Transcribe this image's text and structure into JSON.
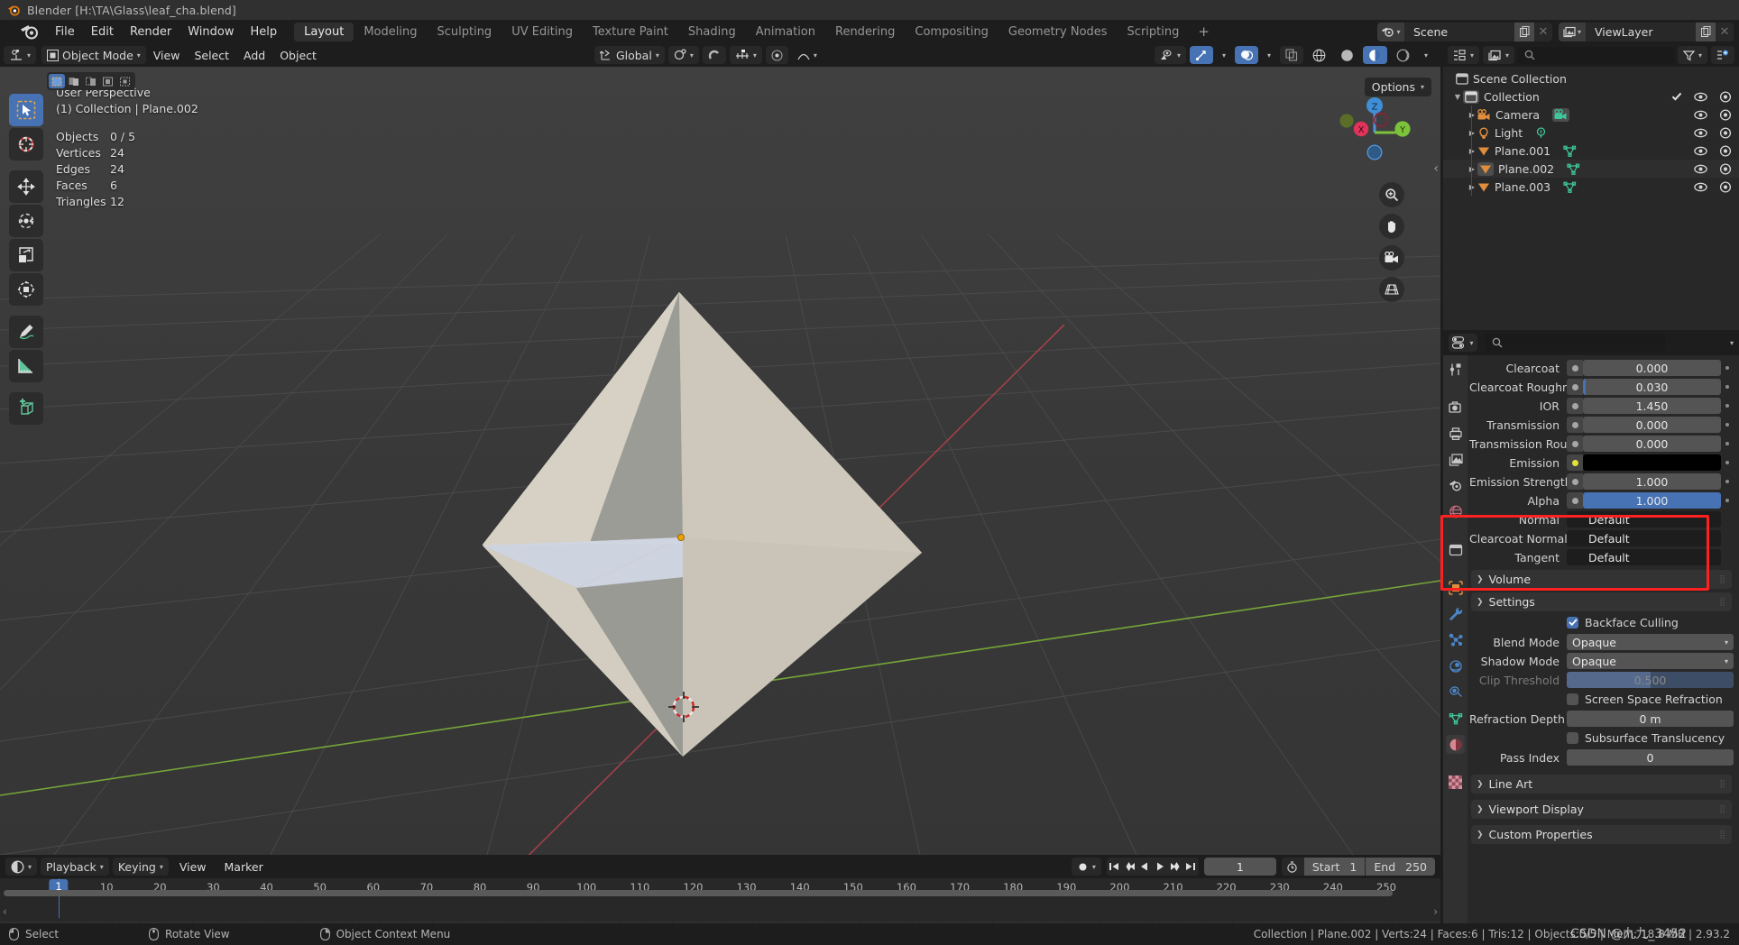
{
  "window": {
    "title": "Blender [H:\\TA\\Glass\\leaf_cha.blend]"
  },
  "menubar": {
    "items": [
      "File",
      "Edit",
      "Render",
      "Window",
      "Help"
    ],
    "workspaces": [
      "Layout",
      "Modeling",
      "Sculpting",
      "UV Editing",
      "Texture Paint",
      "Shading",
      "Animation",
      "Rendering",
      "Compositing",
      "Geometry Nodes",
      "Scripting"
    ],
    "active_workspace": "Layout",
    "add_workspace": "+",
    "scene_name": "Scene",
    "viewlayer_name": "ViewLayer"
  },
  "viewport_header": {
    "mode": "Object Mode",
    "menus": [
      "View",
      "Select",
      "Add",
      "Object"
    ],
    "transform_orientation": "Global",
    "options_label": "Options"
  },
  "viewport": {
    "perspective": "User Perspective",
    "collection_line": "(1) Collection | Plane.002",
    "stats": [
      {
        "label": "Objects",
        "value": "0 / 5"
      },
      {
        "label": "Vertices",
        "value": "24"
      },
      {
        "label": "Edges",
        "value": "24"
      },
      {
        "label": "Faces",
        "value": "6"
      },
      {
        "label": "Triangles",
        "value": "12"
      }
    ],
    "gizmo_axes": [
      "Z",
      "X",
      "Y"
    ]
  },
  "outliner": {
    "root": "Scene Collection",
    "rows": [
      {
        "name": "Collection",
        "indent": 1,
        "type": "collection",
        "selected": false,
        "disclosure": "▼",
        "has_check": true
      },
      {
        "name": "Camera",
        "indent": 2,
        "type": "camera",
        "selected": false,
        "disclosure": "▶",
        "has_check": false
      },
      {
        "name": "Light",
        "indent": 2,
        "type": "light",
        "selected": false,
        "disclosure": "▶",
        "has_check": false
      },
      {
        "name": "Plane.001",
        "indent": 2,
        "type": "mesh",
        "selected": false,
        "disclosure": "▶",
        "has_check": false
      },
      {
        "name": "Plane.002",
        "indent": 2,
        "type": "mesh",
        "selected": true,
        "disclosure": "▶",
        "has_check": false
      },
      {
        "name": "Plane.003",
        "indent": 2,
        "type": "mesh",
        "selected": false,
        "disclosure": "▶",
        "has_check": false
      }
    ]
  },
  "properties": {
    "fields": [
      {
        "label": "Clearcoat",
        "value": "0.000",
        "style": "grey",
        "socket": "grey"
      },
      {
        "label": "Clearcoat Roughn...",
        "value": "0.030",
        "style": "slider",
        "socket": "grey"
      },
      {
        "label": "IOR",
        "value": "1.450",
        "style": "grey",
        "socket": "grey"
      },
      {
        "label": "Transmission",
        "value": "0.000",
        "style": "grey",
        "socket": "grey"
      },
      {
        "label": "Transmission Rou...",
        "value": "0.000",
        "style": "grey",
        "socket": "grey"
      },
      {
        "label": "Emission",
        "value": "",
        "style": "black",
        "socket": "yellow"
      },
      {
        "label": "Emission Strength",
        "value": "1.000",
        "style": "grey",
        "socket": "grey"
      },
      {
        "label": "Alpha",
        "value": "1.000",
        "style": "blue",
        "socket": "grey"
      },
      {
        "label": "Normal",
        "value": "Default",
        "style": "dark",
        "socket": "violet"
      },
      {
        "label": "Clearcoat Normal",
        "value": "Default",
        "style": "dark",
        "socket": "violet"
      },
      {
        "label": "Tangent",
        "value": "Default",
        "style": "dark",
        "socket": "violet"
      }
    ],
    "panels": {
      "volume": "Volume",
      "settings": "Settings",
      "line_art": "Line Art",
      "viewport_display": "Viewport Display",
      "custom_properties": "Custom Properties"
    },
    "settings": {
      "backface_culling_label": "Backface Culling",
      "backface_culling_checked": true,
      "blend_mode_label": "Blend Mode",
      "blend_mode_value": "Opaque",
      "shadow_mode_label": "Shadow Mode",
      "shadow_mode_value": "Opaque",
      "clip_threshold_label": "Clip Threshold",
      "clip_threshold_value": "0.500",
      "screen_space_refraction_label": "Screen Space Refraction",
      "screen_space_refraction_checked": false,
      "refraction_depth_label": "Refraction Depth",
      "refraction_depth_value": "0 m",
      "subsurface_translucency_label": "Subsurface Translucency",
      "subsurface_translucency_checked": false,
      "pass_index_label": "Pass Index",
      "pass_index_value": "0"
    },
    "highlight_color": "#ff2020"
  },
  "timeline": {
    "menus": [
      "Playback",
      "Keying",
      "View",
      "Marker"
    ],
    "current_frame": "1",
    "start_label": "Start",
    "start_value": "1",
    "end_label": "End",
    "end_value": "250",
    "ticks": [
      "1",
      "10",
      "20",
      "30",
      "40",
      "50",
      "60",
      "70",
      "80",
      "90",
      "100",
      "110",
      "120",
      "130",
      "140",
      "150",
      "160",
      "170",
      "180",
      "190",
      "200",
      "210",
      "220",
      "230",
      "240",
      "250"
    ],
    "playhead_frame": "1"
  },
  "statusbar": {
    "hints": [
      {
        "label": "Select",
        "icon": "mouse-left-icon"
      },
      {
        "label": "Rotate View",
        "icon": "mouse-middle-icon"
      },
      {
        "label": "Object Context Menu",
        "icon": "mouse-right-icon"
      }
    ],
    "scene_stats": "Collection | Plane.002 | Verts:24 | Faces:6 | Tris:12 | Objects:0/5 | Mem: 18.8 MB | 2.93.2",
    "watermark": "CSDN @九九_3452"
  },
  "colors": {
    "accent_blue": "#4772b3",
    "highlight_red": "#ff2020",
    "panel_bg": "#282828",
    "header_bg": "#1d1d1d",
    "viewport_bg": "#3b3b3b",
    "mesh_orange": "#e08d3c",
    "mesh_green": "#3ec79b"
  }
}
